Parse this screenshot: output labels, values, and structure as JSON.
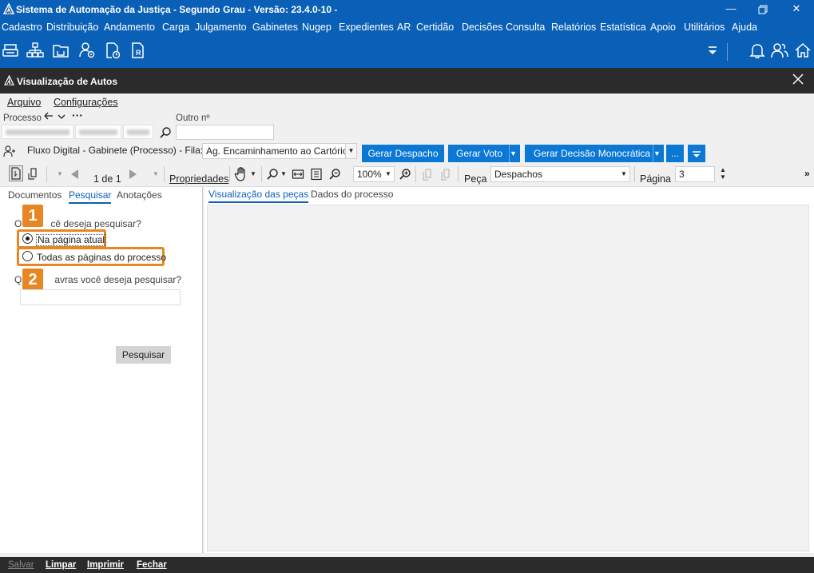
{
  "app": {
    "title": "Sistema de Automação da Justiça - Segundo Grau - Versão: 23.4.0-10 -",
    "accent": "#0a60b6"
  },
  "menu": [
    "Cadastro",
    "Distribuição",
    "Andamento",
    "Carga",
    "Julgamento",
    "Gabinetes",
    "Nugep",
    "Expedientes",
    "AR",
    "Certidão",
    "Decisões",
    "Consulta",
    "Relatórios",
    "Estatística",
    "Apoio",
    "Utilitários",
    "Ajuda"
  ],
  "toolbar_icons": [
    "printer-icon",
    "org-chart-icon",
    "folder-inbox-icon",
    "user-settings-icon",
    "document-clock-icon",
    "document-r-icon"
  ],
  "window": {
    "title": "Visualização de Autos",
    "menu": [
      "Arquivo",
      "Configurações"
    ]
  },
  "form": {
    "processo_label": "Processo",
    "outro_label": "Outro nº",
    "outro_value": "",
    "fluxo_text": "Fluxo Digital - Gabinete (Processo) - Fila:",
    "fila_value": "Ag. Encaminhamento ao Cartório",
    "buttons": {
      "gerar_despacho": "Gerar Despacho",
      "gerar_voto": "Gerar Voto",
      "gerar_decisao": "Gerar Decisão Monocrática",
      "more": "..."
    }
  },
  "viewer_toolbar": {
    "page_counter": "1 de 1",
    "propriedades": "Propriedades",
    "zoom": "100%",
    "peca_label": "Peça",
    "peca_value": "Despachos",
    "pagina_label": "Página",
    "pagina_value": "3"
  },
  "left_tabs": [
    "Documentos",
    "Pesquisar",
    "Anotações"
  ],
  "search": {
    "question1": "Onde você deseja pesquisar?",
    "question1_visible": "cê deseja pesquisar?",
    "option_current": "Na página atual",
    "option_all": "Todas as páginas do processo",
    "question2": "Quais palavras você deseja pesquisar?",
    "question2_visible": "avras você deseja pesquisar?",
    "input_value": "",
    "button": "Pesquisar",
    "badge1": "1",
    "badge2": "2",
    "highlight_color": "#e88624"
  },
  "right_tabs": [
    "Visualização das peças",
    "Dados do processo"
  ],
  "statusbar": [
    "Salvar",
    "Limpar",
    "Imprimir",
    "Fechar"
  ]
}
